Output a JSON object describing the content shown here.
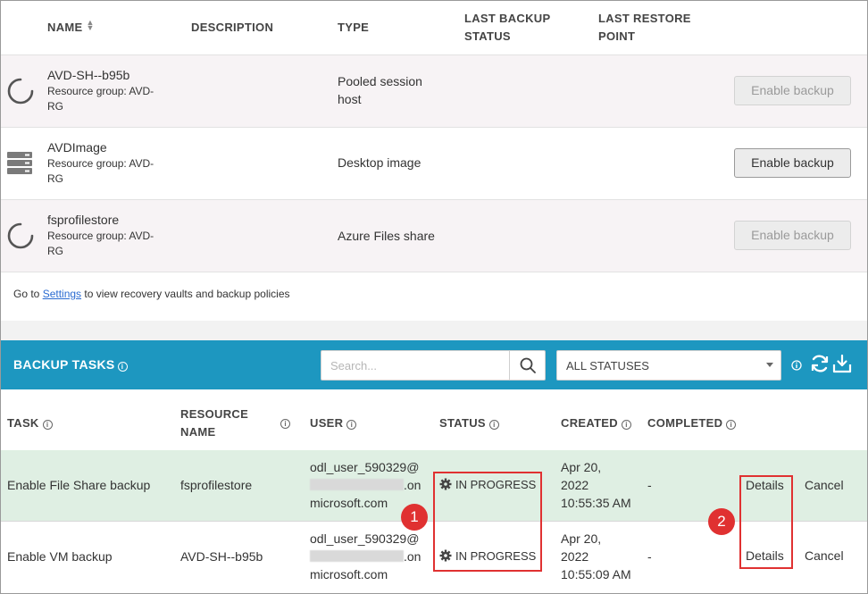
{
  "resources_table": {
    "headers": {
      "name": "NAME",
      "description": "DESCRIPTION",
      "type": "TYPE",
      "last_backup_status_1": "LAST BACKUP",
      "last_backup_status_2": "STATUS",
      "last_restore_point_1": "LAST RESTORE",
      "last_restore_point_2": "POINT"
    },
    "rows": [
      {
        "name": "AVD-SH--b95b",
        "rg_1": "Resource group: AVD-",
        "rg_2": "RG",
        "type_1": "Pooled session",
        "type_2": "host",
        "button": "Enable backup",
        "button_state": "disabled",
        "icon": "loading-spinner-icon"
      },
      {
        "name": "AVDImage",
        "rg_1": "Resource group: AVD-",
        "rg_2": "RG",
        "type_1": "Desktop image",
        "type_2": "",
        "button": "Enable backup",
        "button_state": "enabled",
        "icon": "server-disk-icon"
      },
      {
        "name": "fsprofilestore",
        "rg_1": "Resource group: AVD-",
        "rg_2": "RG",
        "type_1": "Azure Files share",
        "type_2": "",
        "button": "Enable backup",
        "button_state": "disabled",
        "icon": "loading-spinner-icon"
      }
    ],
    "footer": {
      "prefix": "Go to ",
      "link": "Settings",
      "suffix": " to view recovery vaults and backup policies"
    }
  },
  "backup_tasks": {
    "title": "BACKUP TASKS",
    "search_placeholder": "Search...",
    "status_filter": "ALL STATUSES",
    "colors": {
      "bar": "#1d97c0",
      "row_highlight": "#dfefe3",
      "annotation": "#e03131"
    },
    "headers": {
      "task": "TASK",
      "resource_name_1": "RESOURCE",
      "resource_name_2": "NAME",
      "user": "USER",
      "status": "STATUS",
      "created": "CREATED",
      "completed": "COMPLETED"
    },
    "rows": [
      {
        "task": "Enable File Share backup",
        "resource": "fsprofilestore",
        "user_1": "odl_user_590329@",
        "user_2": ".on",
        "user_3": "microsoft.com",
        "status": "IN PROGRESS",
        "created_1": "Apr 20,",
        "created_2": "2022",
        "created_3": "10:55:35 AM",
        "completed": "-",
        "details": "Details",
        "cancel": "Cancel"
      },
      {
        "task": "Enable VM backup",
        "resource": "AVD-SH--b95b",
        "user_1": "odl_user_590329@",
        "user_2": ".on",
        "user_3": "microsoft.com",
        "status": "IN PROGRESS",
        "created_1": "Apr 20,",
        "created_2": "2022",
        "created_3": "10:55:09 AM",
        "completed": "-",
        "details": "Details",
        "cancel": "Cancel"
      }
    ]
  },
  "annotations": {
    "badge_1": "1",
    "badge_2": "2"
  }
}
